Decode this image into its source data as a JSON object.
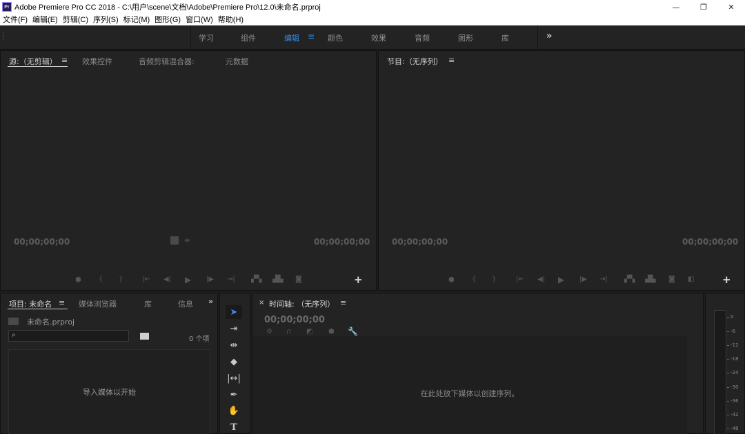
{
  "window": {
    "logo": "Pr",
    "title": "Adobe Premiere Pro CC 2018 - C:\\用户\\scene\\文档\\Adobe\\Premiere Pro\\12.0\\未命名.prproj",
    "minimize": "—",
    "maximize": "❐",
    "close": "✕"
  },
  "menu": [
    "文件(F)",
    "编辑(E)",
    "剪辑(C)",
    "序列(S)",
    "标记(M)",
    "图形(G)",
    "窗口(W)",
    "帮助(H)"
  ],
  "workspaces": {
    "tabs": [
      "学习",
      "组件",
      "编辑",
      "颜色",
      "效果",
      "音频",
      "图形",
      "库"
    ],
    "active": "编辑",
    "menu_icon": "≡",
    "more": "»"
  },
  "source_panel": {
    "tabs": [
      "源:（无剪辑）",
      "效果控件",
      "音频剪辑混合器:",
      "元数据"
    ],
    "menu_icon": "≡",
    "timecode_left": "00;00;00;00",
    "timecode_right": "00;00;00;00",
    "add": "+"
  },
  "program_panel": {
    "tab": "节目:（无序列）",
    "menu_icon": "≡",
    "timecode_left": "00;00;00;00",
    "timecode_right": "00;00;00;00",
    "add": "+"
  },
  "project_panel": {
    "tabs": [
      "项目: 未命名",
      "媒体浏览器",
      "库",
      "信息"
    ],
    "menu_icon": "≡",
    "more": "»",
    "project_file": "未命名.prproj",
    "item_count": "0 个项",
    "drop_hint": "导入媒体以开始"
  },
  "timeline_panel": {
    "close": "×",
    "tab": "时间轴: （无序列）",
    "menu_icon": "≡",
    "timecode": "00;00;00;00",
    "empty_hint": "在此处放下媒体以创建序列。"
  },
  "audio_meter": {
    "labels": [
      "0",
      "-6",
      "-12",
      "-18",
      "-24",
      "-30",
      "-36",
      "-42",
      "-48"
    ]
  },
  "icons": {
    "search": "search-icon",
    "folder": "folder-icon",
    "new_bin": "new-bin-icon",
    "wrench": "wrench-icon"
  }
}
